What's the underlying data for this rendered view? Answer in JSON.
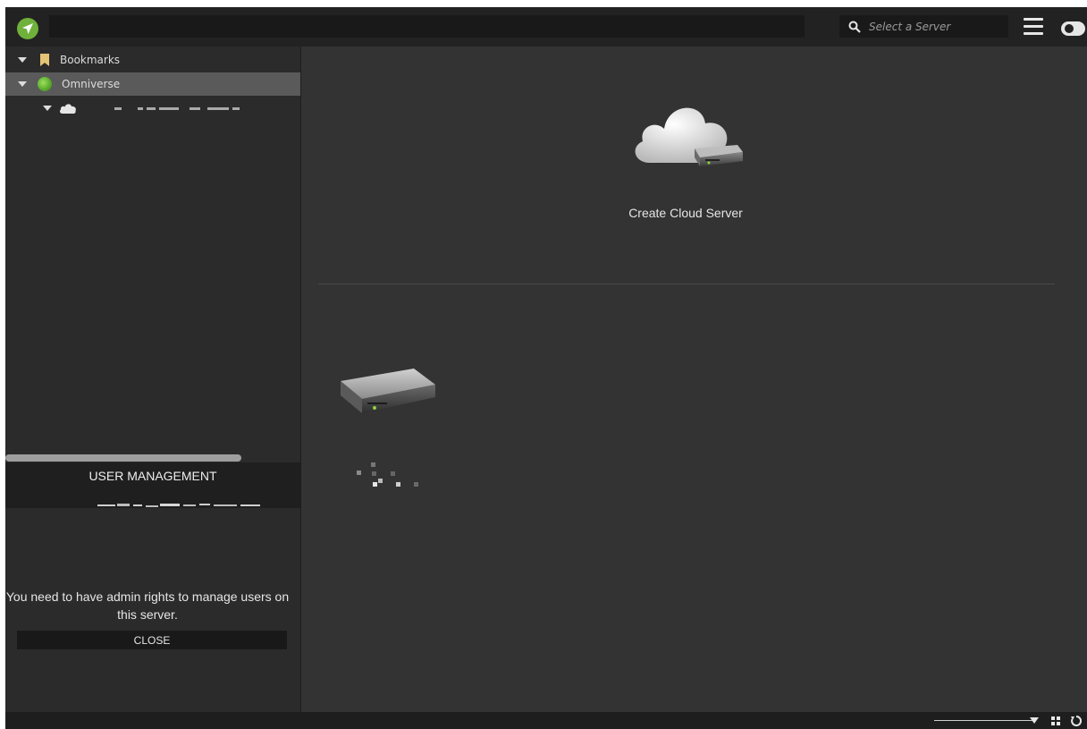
{
  "topbar": {
    "path_value": "",
    "server_search_placeholder": "Select a Server"
  },
  "tree": {
    "items": [
      {
        "label": "Bookmarks",
        "icon": "bookmark-icon"
      },
      {
        "label": "Omniverse",
        "icon": "omniverse-icon"
      },
      {
        "label": "",
        "icon": "cloud-icon"
      }
    ]
  },
  "user_management": {
    "title": "USER MANAGEMENT",
    "message": "You need to have admin rights to manage users on this server.",
    "close_label": "CLOSE"
  },
  "main": {
    "create_cloud_label": "Create Cloud Server"
  },
  "colors": {
    "accent_green": "#6fb13a",
    "bookmark": "#e6c476",
    "panel_bg": "#2b2b2b",
    "main_bg": "#333333"
  }
}
